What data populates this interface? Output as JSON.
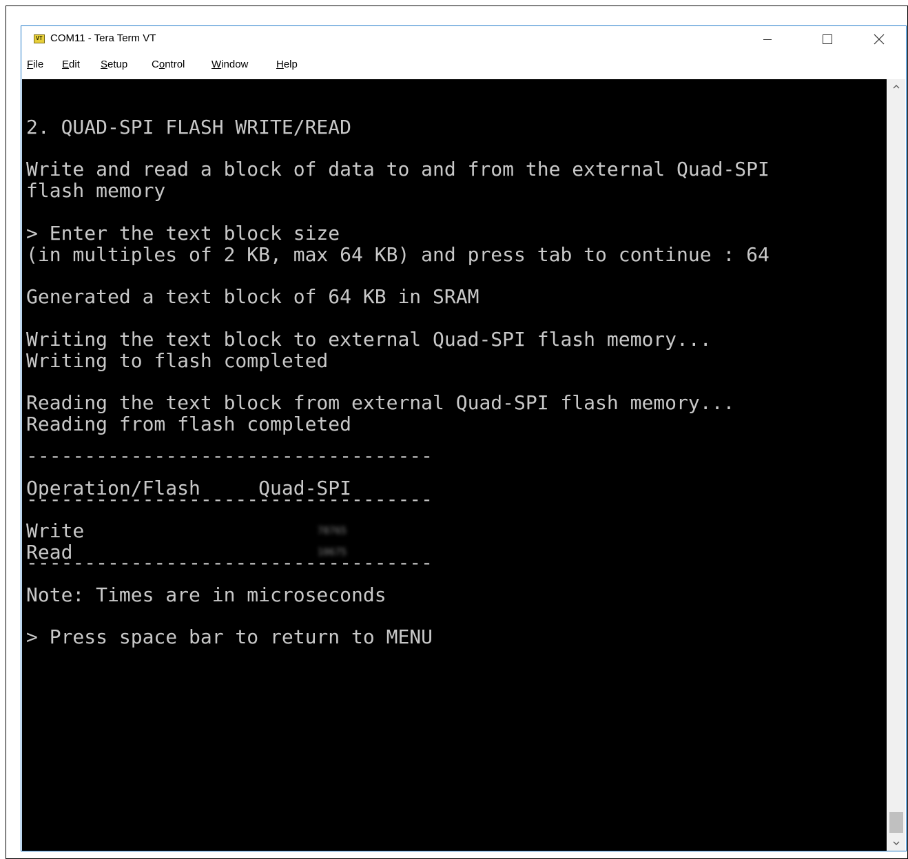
{
  "window": {
    "title": "COM11 - Tera Term VT",
    "icon_label": "VT"
  },
  "menu": [
    {
      "accel": "F",
      "rest": "ile"
    },
    {
      "accel": "E",
      "rest": "dit"
    },
    {
      "accel": "S",
      "rest": "etup"
    },
    {
      "pre": "C",
      "accel": "o",
      "rest": "ntrol"
    },
    {
      "accel": "W",
      "rest": "indow"
    },
    {
      "accel": "H",
      "rest": "elp"
    }
  ],
  "terminal": {
    "lines": [
      "2. QUAD-SPI FLASH WRITE/READ",
      "Write and read a block of data to and from the external Quad-SPI",
      "flash memory",
      "> Enter the text block size",
      "(in multiples of 2 KB, max 64 KB) and press tab to continue : 64",
      "Generated a text block of 64 KB in SRAM",
      "Writing the text block to external Quad-SPI flash memory...",
      "Writing to flash completed",
      "Reading the text block from external Quad-SPI flash memory...",
      "Reading from flash completed",
      "-----------------------------------",
      "Operation/Flash     Quad-SPI",
      "-----------------------------------",
      "Write",
      "Read",
      "-----------------------------------",
      "Note: Times are in microseconds",
      "> Press space bar to return to MENU"
    ],
    "redacted_values": {
      "write_time": "78765",
      "read_time": "10675"
    }
  },
  "colors": {
    "terminal_bg": "#000000",
    "terminal_fg": "#c8c8c8",
    "window_border": "#1e78c8"
  }
}
